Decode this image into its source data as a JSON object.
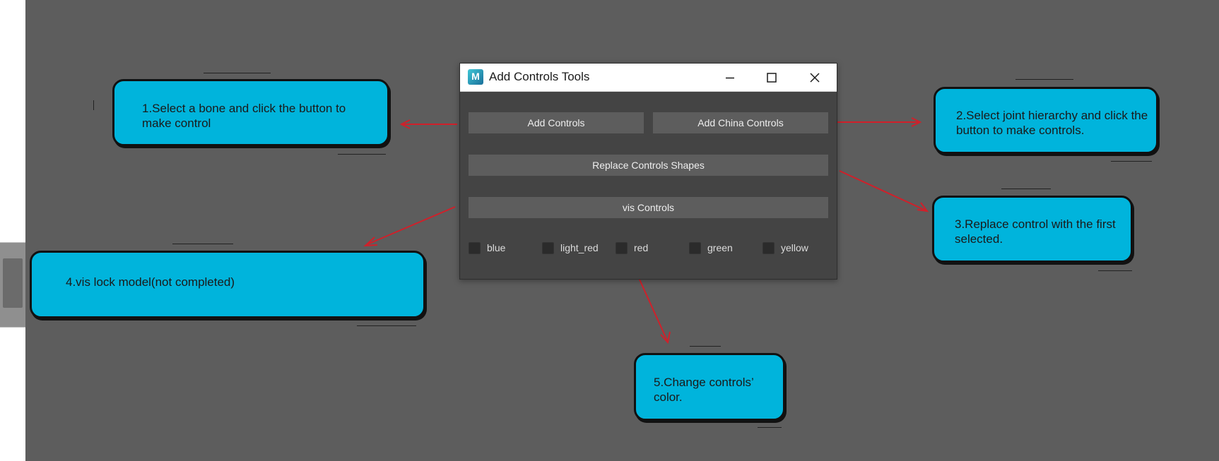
{
  "window": {
    "title": "Add Controls Tools",
    "app_icon_letter": "M"
  },
  "buttons": {
    "add_controls": "Add Controls",
    "add_china_controls": "Add China Controls",
    "replace_controls_shapes": "Replace Controls Shapes",
    "vis_controls": "vis Controls"
  },
  "colors": [
    {
      "label": "blue"
    },
    {
      "label": "light_red"
    },
    {
      "label": "red"
    },
    {
      "label": "green"
    },
    {
      "label": "yellow"
    }
  ],
  "callouts": {
    "c1": "1.Select a bone and click the button to make control",
    "c2": "2.Select joint hierarchy and click the button to make controls.",
    "c3": "3.Replace control with the first selected.",
    "c4": "4.vis lock model(not completed)",
    "c5": "5.Change controls’ color."
  },
  "style": {
    "canvas_bg": "#5d5d5d",
    "dialog_bg": "#444444",
    "button_bg": "#5d5d5d",
    "callout_fill": "#00b4dc",
    "arrow_color": "#d0202a"
  }
}
